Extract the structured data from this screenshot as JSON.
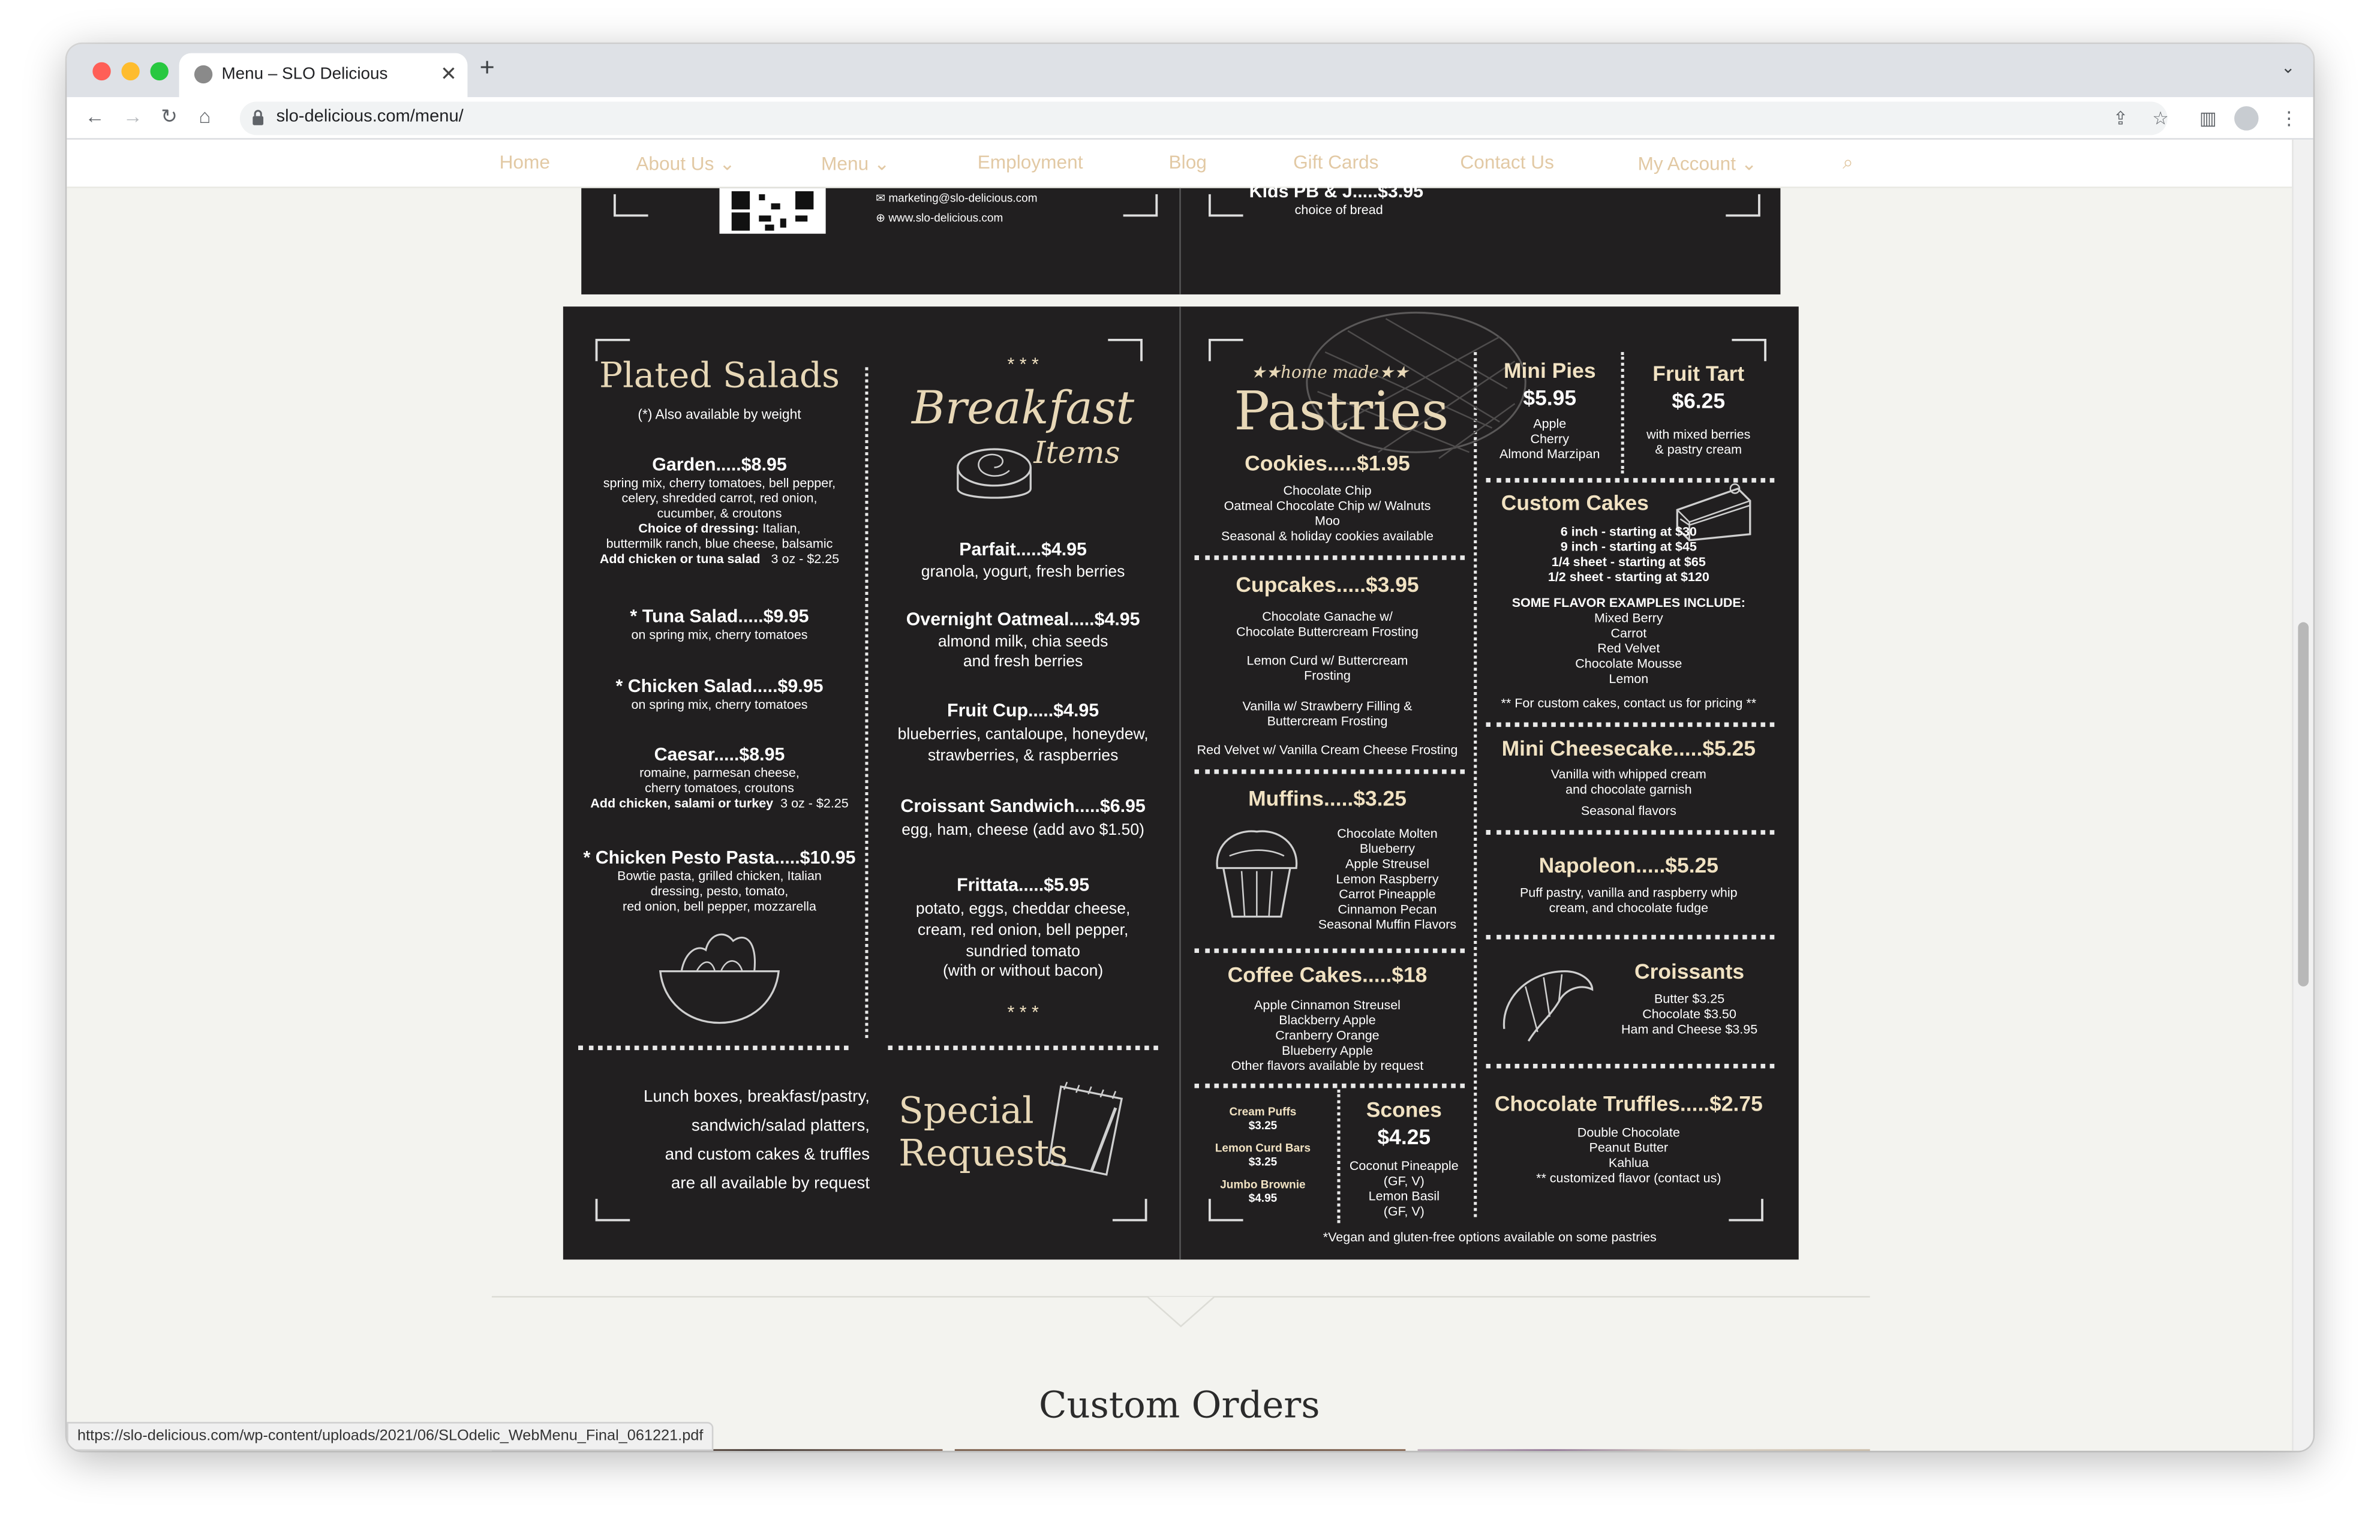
{
  "browser": {
    "tab_title": "Menu – SLO Delicious",
    "url": "slo-delicious.com/menu/",
    "status_url": "https://slo-delicious.com/wp-content/uploads/2021/06/SLOdelic_WebMenu_Final_061221.pdf"
  },
  "site_nav": {
    "home": "Home",
    "about": "About Us",
    "menu": "Menu",
    "employment": "Employment",
    "blog": "Blog",
    "gift_cards": "Gift Cards",
    "contact": "Contact Us",
    "account": "My Account"
  },
  "top_panel": {
    "email": "marketing@slo-delicious.com",
    "web": "www.slo-delicious.com",
    "kids_item": "Kids PB & J.....$3.95",
    "kids_desc": "choice of bread"
  },
  "salads": {
    "heading": "Plated Salads",
    "note": "(*) Also available by weight",
    "garden": {
      "title": "Garden.....$8.95",
      "l1": "spring mix, cherry tomatoes, bell pepper,",
      "l2": "celery, shredded carrot, red onion,",
      "l3": "cucumber, & croutons",
      "dressing_label": "Choice of dressing:",
      "dressing_1": "Italian,",
      "l5": "buttermilk ranch, blue cheese, balsamic",
      "addon_label": "Add chicken or tuna salad",
      "addon_price": "3 oz - $2.25"
    },
    "tuna": {
      "title": "* Tuna Salad.....$9.95",
      "desc": "on spring mix, cherry tomatoes"
    },
    "chicken": {
      "title": "* Chicken Salad.....$9.95",
      "desc": "on spring mix, cherry tomatoes"
    },
    "caesar": {
      "title": "Caesar.....$8.95",
      "l1": "romaine, parmesan cheese,",
      "l2": "cherry tomatoes, croutons",
      "addon_label": "Add chicken, salami or turkey",
      "addon_price": "3 oz - $2.25"
    },
    "pesto": {
      "title": "* Chicken Pesto Pasta.....$10.95",
      "l1": "Bowtie pasta, grilled chicken, Italian",
      "l2": "dressing, pesto, tomato,",
      "l3": "red onion, bell pepper, mozzarella"
    }
  },
  "breakfast": {
    "stars_top": "* * *",
    "heading_1": "Breakfast",
    "heading_2": "Items",
    "parfait": {
      "title": "Parfait.....$4.95",
      "desc": "granola, yogurt, fresh berries"
    },
    "oatmeal": {
      "title": "Overnight Oatmeal.....$4.95",
      "l1": "almond milk, chia seeds",
      "l2": "and fresh berries"
    },
    "fruit": {
      "title": "Fruit Cup.....$4.95",
      "l1": "blueberries, cantaloupe, honeydew,",
      "l2": "strawberries, & raspberries"
    },
    "croissant": {
      "title": "Croissant Sandwich.....$6.95",
      "desc": "egg, ham, cheese    (add avo $1.50)"
    },
    "frittata": {
      "title": "Frittata.....$5.95",
      "l1": "potato, eggs, cheddar cheese,",
      "l2": "cream, red onion, bell pepper,",
      "l3": "sundried tomato",
      "l4": "(with or without bacon)"
    },
    "stars_bottom": "* * *"
  },
  "requests": {
    "l1": "Lunch boxes, breakfast/pastry,",
    "l2": "sandwich/salad platters,",
    "l3": "and custom cakes & truffles",
    "l4": "are all available by request",
    "heading_1": "Special",
    "heading_2": "Requests"
  },
  "pastries": {
    "tagline": "★★home made★★",
    "heading": "Pastries",
    "cookies": {
      "title": "Cookies.....$1.95",
      "l1": "Chocolate Chip",
      "l2": "Oatmeal Chocolate Chip w/ Walnuts",
      "l3": "Moo",
      "l4": "Seasonal & holiday cookies available"
    },
    "cupcakes": {
      "title": "Cupcakes.....$3.95",
      "l1": "Chocolate Ganache w/",
      "l2": "Chocolate Buttercream Frosting",
      "l3": "Lemon Curd w/ Buttercream",
      "l4": "Frosting",
      "l5": "Vanilla w/ Strawberry Filling &",
      "l6": "Buttercream Frosting",
      "l7": "Red Velvet w/ Vanilla Cream Cheese Frosting"
    },
    "muffins": {
      "title": "Muffins.....$3.25",
      "flavors": [
        "Chocolate Molten",
        "Blueberry",
        "Apple Streusel",
        "Lemon Raspberry",
        "Carrot Pineapple",
        "Cinnamon Pecan",
        "Seasonal Muffin Flavors"
      ]
    },
    "coffee_cakes": {
      "title": "Coffee Cakes.....$18",
      "flavors": [
        "Apple Cinnamon Streusel",
        "Blackberry Apple",
        "Cranberry Orange",
        "Blueberry Apple",
        "Other flavors available by request"
      ]
    },
    "small": {
      "cream_puffs": "Cream Puffs",
      "cream_puffs_price": "$3.25",
      "lemon_bars": "Lemon Curd Bars",
      "lemon_bars_price": "$3.25",
      "brownie": "Jumbo Brownie",
      "brownie_price": "$4.95"
    },
    "scones": {
      "title": "Scones",
      "price": "$4.25",
      "l1": "Coconut Pineapple",
      "l2": "(GF, V)",
      "l3": "Lemon Basil",
      "l4": "(GF, V)"
    },
    "mini_pies": {
      "title": "Mini Pies",
      "price": "$5.95",
      "l1": "Apple",
      "l2": "Cherry",
      "l3": "Almond Marzipan"
    },
    "fruit_tart": {
      "title": "Fruit Tart",
      "price": "$6.25",
      "l1": "with mixed berries",
      "l2": "& pastry cream"
    },
    "custom_cakes": {
      "title": "Custom Cakes",
      "sizes": [
        "6 inch - starting at $30",
        "9 inch - starting at $45",
        "1/4 sheet - starting at $65",
        "1/2 sheet - starting at $120"
      ],
      "examples_label": "SOME FLAVOR EXAMPLES INCLUDE:",
      "flavors": [
        "Mixed Berry",
        "Carrot",
        "Red Velvet",
        "Chocolate Mousse",
        "Lemon"
      ],
      "note": "** For custom cakes, contact us for pricing **"
    },
    "cheesecake": {
      "title": "Mini Cheesecake.....$5.25",
      "l1": "Vanilla with whipped cream",
      "l2": "and chocolate garnish",
      "l3": "Seasonal flavors"
    },
    "napoleon": {
      "title": "Napoleon.....$5.25",
      "l1": "Puff pastry, vanilla and raspberry whip",
      "l2": "cream, and chocolate fudge"
    },
    "croissants": {
      "title": "Croissants",
      "butter": "Butter     $3.25",
      "chocolate": "Chocolate     $3.50",
      "ham": "Ham and Cheese     $3.95"
    },
    "truffles": {
      "title": "Chocolate Truffles.....$2.75",
      "l1": "Double Chocolate",
      "l2": "Peanut Butter",
      "l3": "Kahlua",
      "l4": "** customized flavor  (contact us)"
    },
    "footnote": "*Vegan and gluten-free options available on some pastries"
  },
  "custom_orders": {
    "heading": "Custom Orders"
  },
  "colors": {
    "menu_bg": "#211f20",
    "heading_gold": "#e8d8b7",
    "nav_text": "#e2c9a4",
    "page_bg": "#f3f3ef"
  }
}
